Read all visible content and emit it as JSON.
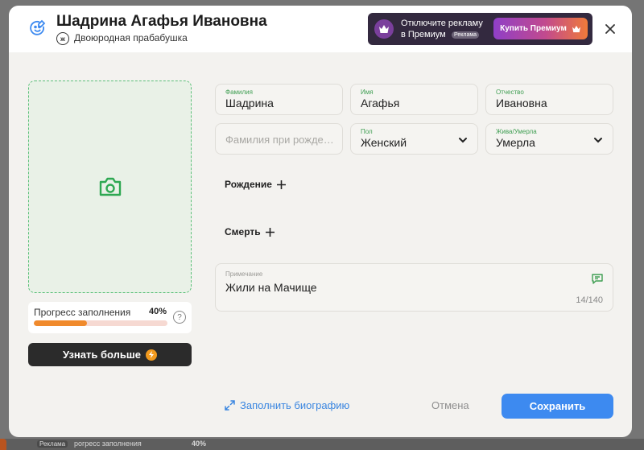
{
  "header": {
    "name": "Шадрина Агафья Ивановна",
    "gender_badge": "ж",
    "relation": "Двоюродная прабабушка"
  },
  "promo": {
    "line1": "Отключите рекламу",
    "line2": "в Премиум",
    "tag": "Реклама",
    "button_label": "Купить Премиум"
  },
  "progress": {
    "label": "Прогресс заполнения",
    "percent_text": "40%",
    "value": 0.4
  },
  "learn_more": {
    "label": "Узнать больше"
  },
  "fields": {
    "surname": {
      "label": "Фамилия",
      "value": "Шадрина"
    },
    "first_name": {
      "label": "Имя",
      "value": "Агафья"
    },
    "patronymic": {
      "label": "Отчество",
      "value": "Ивановна"
    },
    "birth_surname": {
      "placeholder": "Фамилия при рождении"
    },
    "gender": {
      "label": "Пол",
      "value": "Женский"
    },
    "status": {
      "label": "Жива/Умерла",
      "value": "Умерла"
    }
  },
  "sections": {
    "birth": "Рождение",
    "death": "Смерть"
  },
  "note": {
    "label": "Примечание",
    "value": "Жили на Мачище",
    "counter": "14/140"
  },
  "footer": {
    "bio_link": "Заполнить биографию",
    "cancel": "Отмена",
    "save": "Сохранить"
  },
  "background": {
    "badge": "Реклама",
    "progress_text": "рогресс заполнения",
    "progress_pct": "40%"
  },
  "colors": {
    "accent_green": "#3f9e52",
    "primary_blue": "#3d8af0",
    "progress_orange": "#f08a2c"
  }
}
